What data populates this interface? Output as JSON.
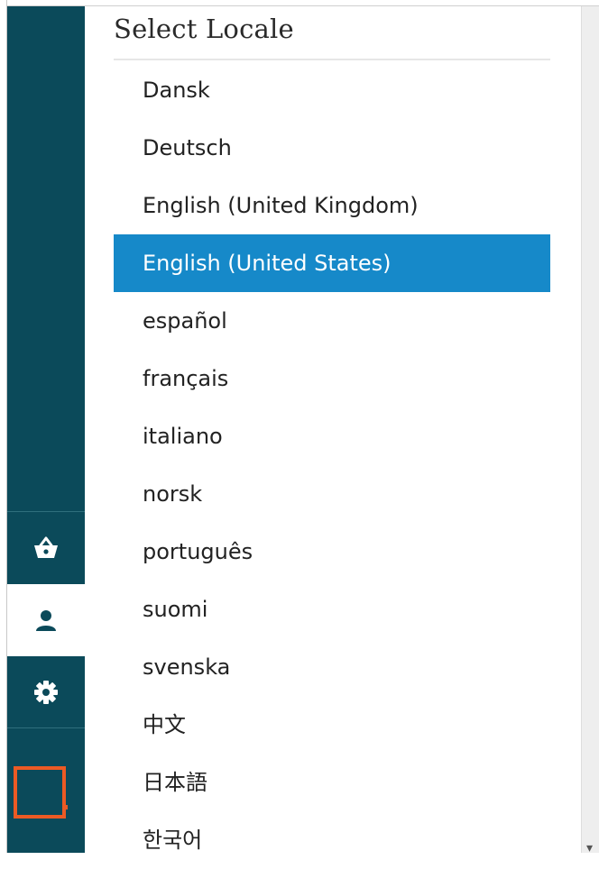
{
  "locale_panel": {
    "title": "Select Locale",
    "items": [
      "Dansk",
      "Deutsch",
      "English (United Kingdom)",
      "English (United States)",
      "español",
      "français",
      "italiano",
      "norsk",
      "português",
      "suomi",
      "svenska",
      "中文",
      "日本語",
      "한국어"
    ],
    "selected": "English (United States)"
  },
  "sidebar": {
    "icons": [
      "basket-icon",
      "user-icon",
      "gear-icon"
    ],
    "active": "user-icon"
  },
  "colors": {
    "sidebar_bg": "#0b4a5a",
    "selected_bg": "#1689c9",
    "logo_accent": "#ec5a24"
  }
}
